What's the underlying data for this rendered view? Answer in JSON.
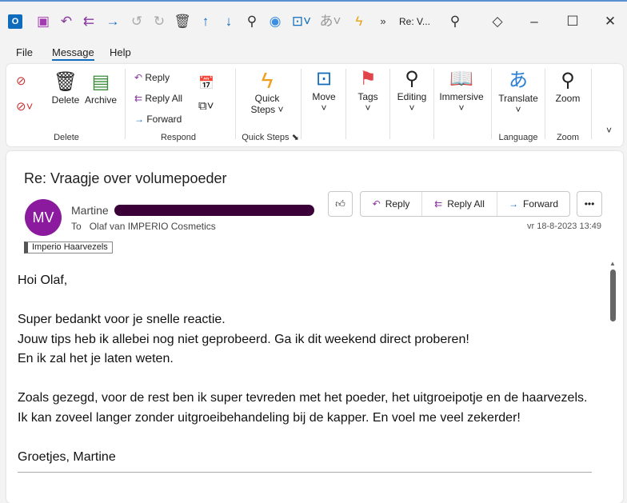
{
  "titlebar": {
    "title": "Re: V...",
    "colors": {
      "accent": "#0f6cbd",
      "purple": "#8a3a9f"
    }
  },
  "tabs": [
    {
      "label": "File"
    },
    {
      "label": "Message",
      "active": true
    },
    {
      "label": "Help"
    }
  ],
  "ribbon": {
    "delete_group": {
      "label": "Delete",
      "delete": "Delete",
      "archive": "Archive"
    },
    "respond_group": {
      "label": "Respond",
      "reply": "Reply",
      "reply_all": "Reply All",
      "forward": "Forward"
    },
    "quick_steps_group": {
      "label": "Quick Steps",
      "button_line1": "Quick",
      "button_line2": "Steps"
    },
    "move": "Move",
    "tags": "Tags",
    "editing": "Editing",
    "immersive": "Immersive",
    "language_group": {
      "label": "Language",
      "translate": "Translate"
    },
    "zoom_group": {
      "label": "Zoom",
      "zoom": "Zoom"
    }
  },
  "message": {
    "subject": "Re: Vraagje over volumepoeder",
    "avatar_initials": "MV",
    "avatar_color": "#8b1a9f",
    "sender": "Martine",
    "to_label": "To",
    "to": "Olaf van IMPERIO Cosmetics",
    "date": "vr 18-8-2023 13:49",
    "category": "Imperio Haarvezels",
    "actions": {
      "reply": "Reply",
      "reply_all": "Reply All",
      "forward": "Forward"
    },
    "body": [
      "Hoi Olaf,",
      "",
      "Super bedankt voor je snelle reactie.",
      "Jouw tips heb ik allebei nog niet geprobeerd. Ga ik dit weekend direct proberen!",
      "En ik zal het je laten weten.",
      "",
      "Zoals gezegd, voor de rest ben ik super tevreden met het poeder, het uitgroeipotje en de haarvezels. Ik kan zoveel langer zonder uitgroeibehandeling bij de kapper. En voel me veel zekerder!",
      "",
      "Groetjes, Martine"
    ]
  }
}
